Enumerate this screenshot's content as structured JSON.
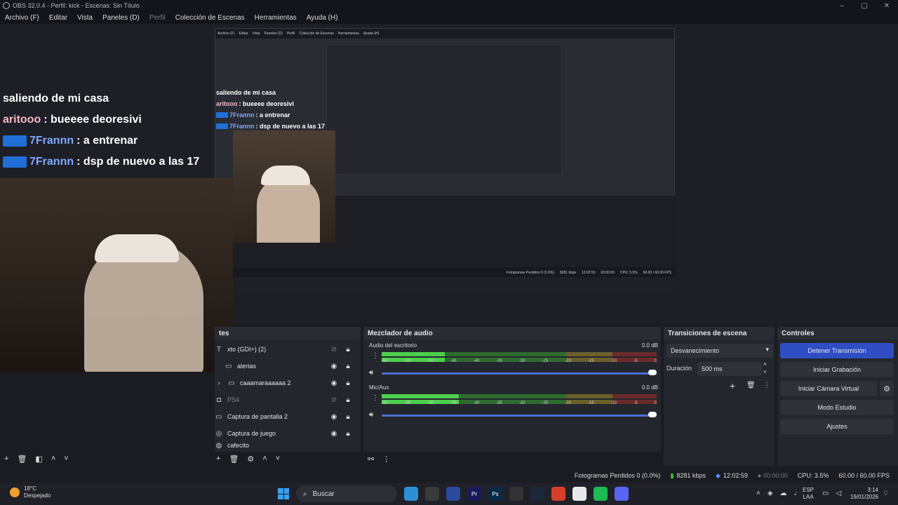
{
  "titlebar": {
    "title": "OBS 32.0.4 - Perfil: kick - Escenas: Sin Título",
    "min": "–",
    "max": "▢",
    "close": "✕"
  },
  "menu": [
    "Archivo (F)",
    "Editar",
    "Vista",
    "Paneles (D)",
    "Perfil",
    "Colección de Escenas",
    "Herramientas",
    "Ayuda (H)"
  ],
  "nested": {
    "menu": [
      "Archivo (F)",
      "Editar",
      "Vista",
      "Paneles (D)",
      "Perfil",
      "Colección de Escenas",
      "Herramientas",
      "Ayuda (H)"
    ],
    "status": [
      "Fotogramas Perdidos 0 (0.0%)",
      "8281 kbps",
      "12:02:59",
      "00:00:00",
      "CPU: 5.5%",
      "60.00 / 60.00 FPS"
    ]
  },
  "chat": {
    "title": "saliendo de mi casa",
    "lines": [
      {
        "user": "aritooo",
        "text": ": bueeee deoresivi",
        "color": "pink"
      },
      {
        "user": "7Frannn",
        "text": ": a entrenar",
        "color": "blue"
      },
      {
        "user": "7Frannn",
        "text": ": dsp de nuevo a las 17",
        "color": "blue"
      }
    ]
  },
  "docks": {
    "sources_header": "tes",
    "mixer_header": "Mezclador de audio",
    "transitions_header": "Transiciones de escena",
    "controls_header": "Controles"
  },
  "sources": [
    {
      "name": "xto (GDI+) (2)",
      "icon": "text-icon",
      "visible": false
    },
    {
      "name": "alertas",
      "icon": "folder-icon",
      "visible": true
    },
    {
      "name": "caaamaraaaaaa 2",
      "icon": "folder-icon",
      "visible": true
    },
    {
      "name": "PS4",
      "icon": "camera-icon",
      "visible": false
    },
    {
      "name": "Captura de pantalla 2",
      "icon": "monitor-icon",
      "visible": true
    },
    {
      "name": "Captura de juego",
      "icon": "gamepad-icon",
      "visible": true
    },
    {
      "name": "cafecito",
      "icon": "globe-icon",
      "visible": true
    }
  ],
  "mixer": {
    "tracks": [
      {
        "name": "Audio del escritorio",
        "db": "0.0 dB",
        "level": 0.23
      },
      {
        "name": "Mic/Aux",
        "db": "0.0 dB",
        "level": 0.28
      }
    ],
    "scale": [
      "-60",
      "-55",
      "-50",
      "-45",
      "-40",
      "-35",
      "-30",
      "-25",
      "-20",
      "-15",
      "-10",
      "-5",
      "0"
    ]
  },
  "transitions": {
    "selected": "Desvanecimiento",
    "duration_label": "Duración",
    "duration_value": "500 ms"
  },
  "controls": {
    "stop_stream": "Detener Transmisión",
    "start_rec": "Iniciar Grabación",
    "virtual_cam": "Iniciar Cámara Virtual",
    "studio": "Modo Estudio",
    "settings": "Ajustes"
  },
  "status": {
    "dropped": "Fotogramas Perdidos 0 (0.0%)",
    "kbps": "8281 kbps",
    "stream_time": "12:02:59",
    "rec_time": "00:00:00",
    "cpu": "CPU: 3.5%",
    "fps": "60.00 / 60.00 FPS"
  },
  "taskbar": {
    "temp": "18°C",
    "weather": "Despejado",
    "search": "Buscar",
    "lang1": "ESP",
    "lang2": "LAA",
    "time": "3:14",
    "date": "19/01/2026"
  }
}
